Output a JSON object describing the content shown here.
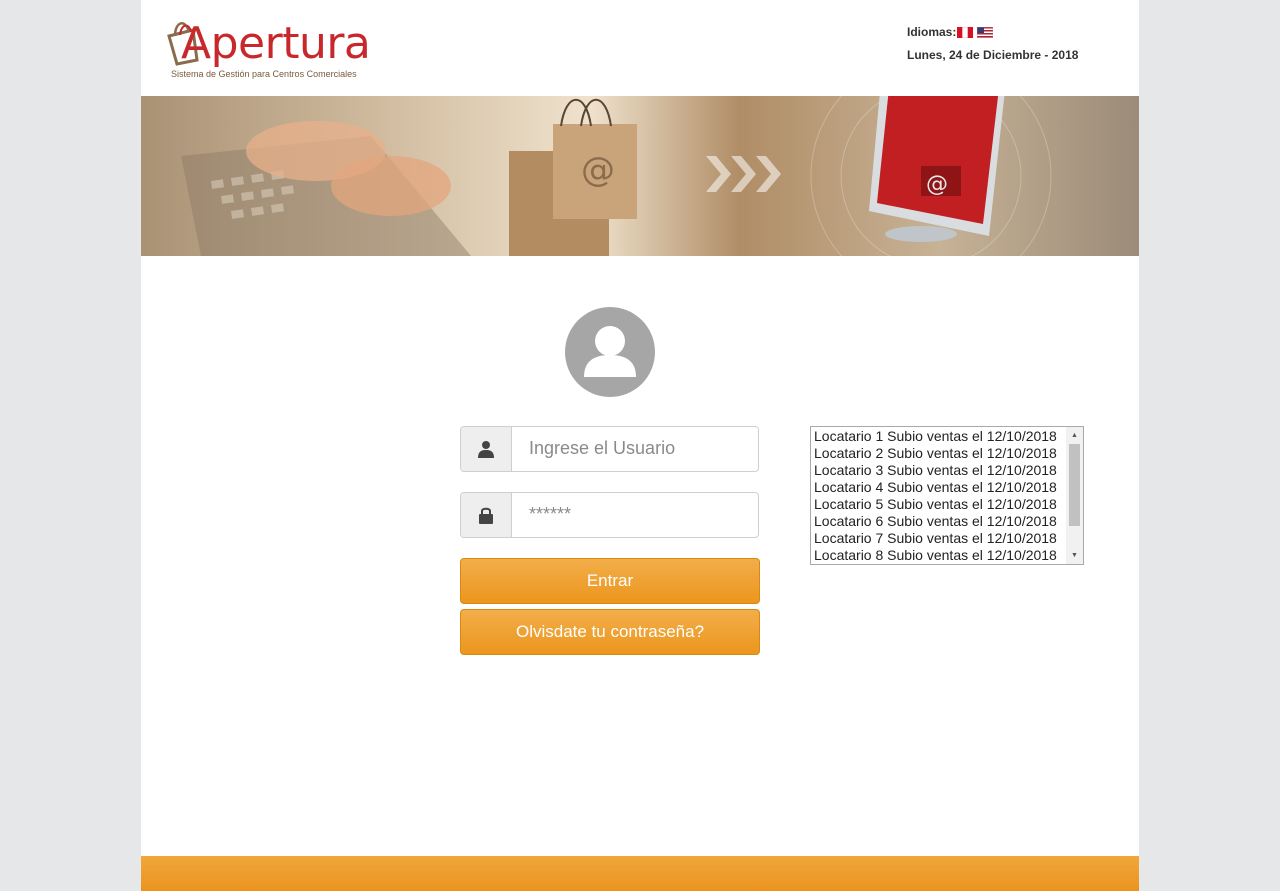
{
  "header": {
    "logo_text": "Apertura",
    "logo_subtitle": "Sistema de Gestión para Centros Comerciales",
    "languages_label": "Idiomas:",
    "languages": [
      "peru-flag-icon",
      "usa-flag-icon"
    ],
    "date": "Lunes, 24 de Diciembre - 2018"
  },
  "login": {
    "avatar_icon": "user-avatar-icon",
    "username_placeholder": "Ingrese el Usuario",
    "username_icon": "user-icon",
    "password_placeholder": "******",
    "password_icon": "lock-icon",
    "submit_label": "Entrar",
    "forgot_label": "Olvisdate tu contraseña?"
  },
  "notifications": {
    "items": [
      "Locatario 1 Subio ventas el 12/10/2018",
      "Locatario 2 Subio ventas el 12/10/2018",
      "Locatario 3 Subio ventas el 12/10/2018",
      "Locatario 4 Subio ventas el 12/10/2018",
      "Locatario 5 Subio ventas el 12/10/2018",
      "Locatario 6 Subio ventas el 12/10/2018",
      "Locatario 7 Subio ventas el 12/10/2018",
      "Locatario 8 Subio ventas el 12/10/2018"
    ]
  },
  "colors": {
    "brand_red": "#c8282b",
    "accent_orange": "#ec961d",
    "avatar_gray": "#a6a6a6"
  }
}
